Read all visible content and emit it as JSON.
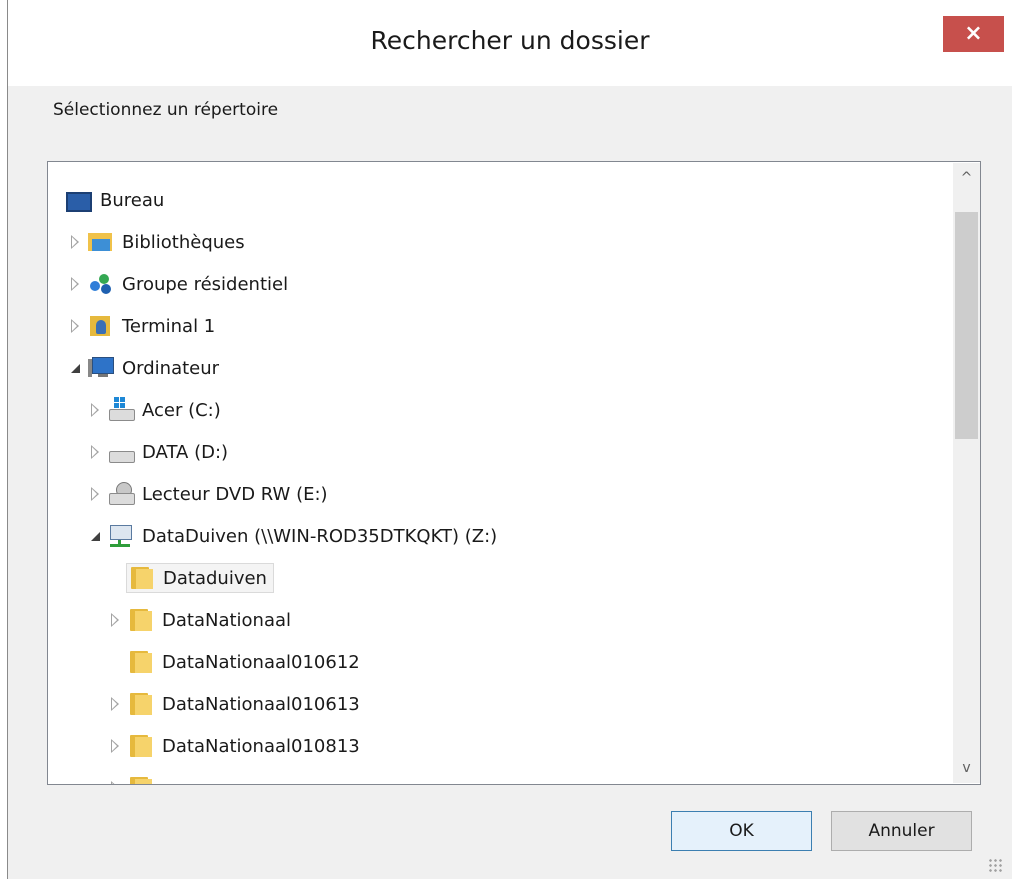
{
  "dialog": {
    "title": "Rechercher un dossier",
    "close_label": "×",
    "prompt": "Sélectionnez un répertoire"
  },
  "tree": {
    "items": [
      {
        "label": "Bureau",
        "icon": "desktop-icon"
      },
      {
        "label": "Bibliothèques",
        "icon": "libraries-icon"
      },
      {
        "label": "Groupe résidentiel",
        "icon": "homegroup-icon"
      },
      {
        "label": "Terminal 1",
        "icon": "user-folder-icon"
      },
      {
        "label": "Ordinateur",
        "icon": "computer-icon"
      },
      {
        "label": "Acer (C:)",
        "icon": "windows-drive-icon"
      },
      {
        "label": "DATA (D:)",
        "icon": "drive-icon"
      },
      {
        "label": "Lecteur DVD RW (E:)",
        "icon": "dvd-drive-icon"
      },
      {
        "label": "DataDuiven (\\\\WIN-ROD35DTKQKT) (Z:)",
        "icon": "network-drive-icon"
      },
      {
        "label": "Dataduiven",
        "icon": "folder-icon",
        "selected": true
      },
      {
        "label": "DataNationaal",
        "icon": "folder-icon"
      },
      {
        "label": "DataNationaal010612",
        "icon": "folder-icon"
      },
      {
        "label": "DataNationaal010613",
        "icon": "folder-icon"
      },
      {
        "label": "DataNationaal010813",
        "icon": "folder-icon"
      }
    ]
  },
  "scrollbar": {
    "up_label": "^",
    "down_label": "v"
  },
  "buttons": {
    "ok": "OK",
    "cancel": "Annuler"
  }
}
